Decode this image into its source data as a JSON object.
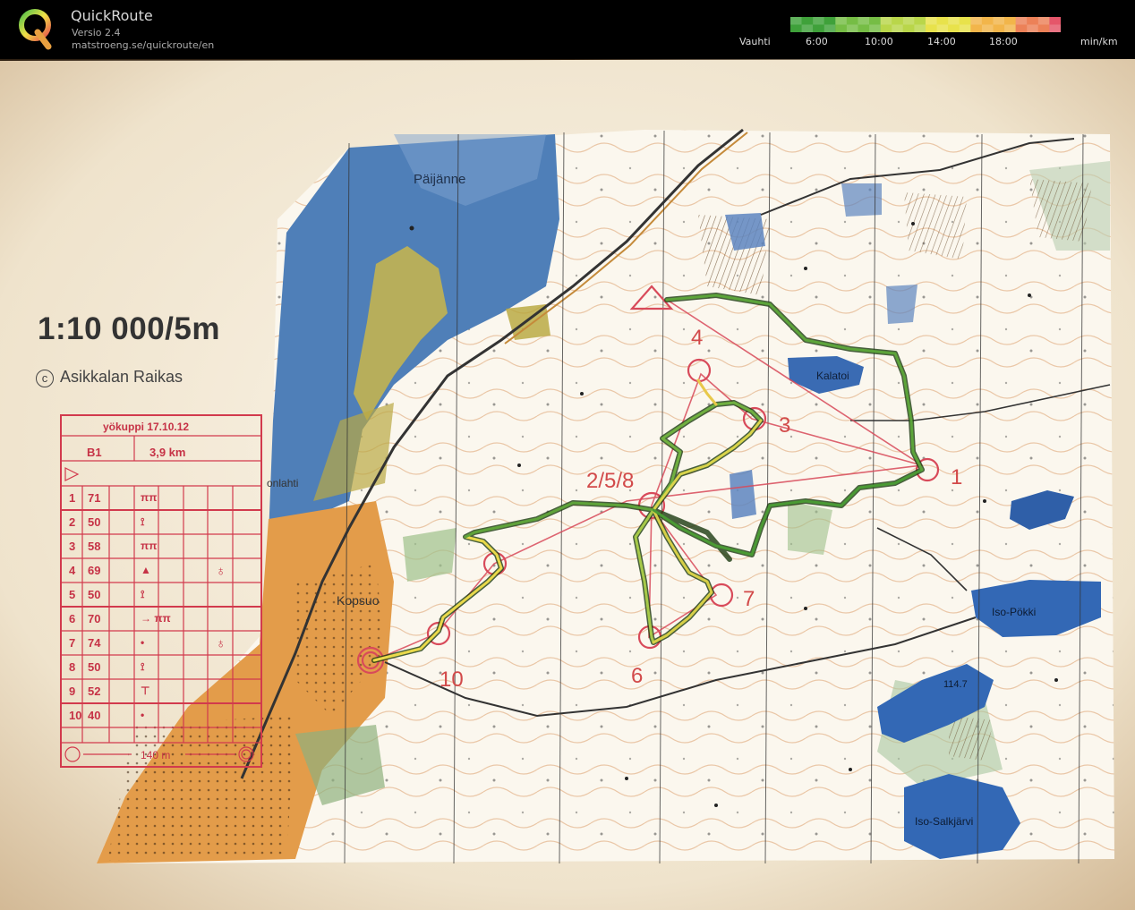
{
  "header": {
    "app_name": "QuickRoute",
    "version": "Versio 2.4",
    "url": "matstroeng.se/quickroute/en"
  },
  "pace_legend": {
    "label": "Vauhti",
    "ticks": [
      "6:00",
      "10:00",
      "14:00",
      "18:00"
    ],
    "unit": "min/km",
    "colors": [
      "#3fa13a",
      "#76bd45",
      "#b9d64a",
      "#e8e24b",
      "#f2b54a",
      "#ec8158",
      "#e5566a"
    ]
  },
  "map": {
    "scale": "1:10 000/5m",
    "copyright_symbol": "c",
    "club": "Asikkalan Raikas",
    "place_names": {
      "paijanne": "Päijänne",
      "kalatoi": "Kalatoi",
      "iso_pokki": "Iso-Pökki",
      "iso_salkjarvi": "Iso-Salkjärvi",
      "kopsuo": "Kopsuo",
      "lahti": "onlahti",
      "height": "114.7"
    },
    "controls": {
      "c1": "1",
      "c258": "2/5/8",
      "c3": "3",
      "c4": "4",
      "c6": "6",
      "c7": "7",
      "c10": "10"
    }
  },
  "control_card": {
    "event": "yökuppi 17.10.12",
    "class": "B1",
    "length": "3,9 km",
    "rows": [
      {
        "num": "1",
        "code": "71",
        "symbol": "ππ",
        "extra": ""
      },
      {
        "num": "2",
        "code": "50",
        "symbol": "⟟",
        "extra": ""
      },
      {
        "num": "3",
        "code": "58",
        "symbol": "ππ",
        "extra": ""
      },
      {
        "num": "4",
        "code": "69",
        "symbol": "▲",
        "extra": "♁"
      },
      {
        "num": "5",
        "code": "50",
        "symbol": "⟟",
        "extra": ""
      },
      {
        "num": "6",
        "code": "70",
        "symbol": "→ ππ",
        "extra": ""
      },
      {
        "num": "7",
        "code": "74",
        "symbol": "•",
        "extra": "♁"
      },
      {
        "num": "8",
        "code": "50",
        "symbol": "⟟",
        "extra": ""
      },
      {
        "num": "9",
        "code": "52",
        "symbol": "⊤",
        "extra": ""
      },
      {
        "num": "10",
        "code": "40",
        "symbol": "•",
        "extra": ""
      }
    ],
    "finish_distance": "140 m"
  }
}
